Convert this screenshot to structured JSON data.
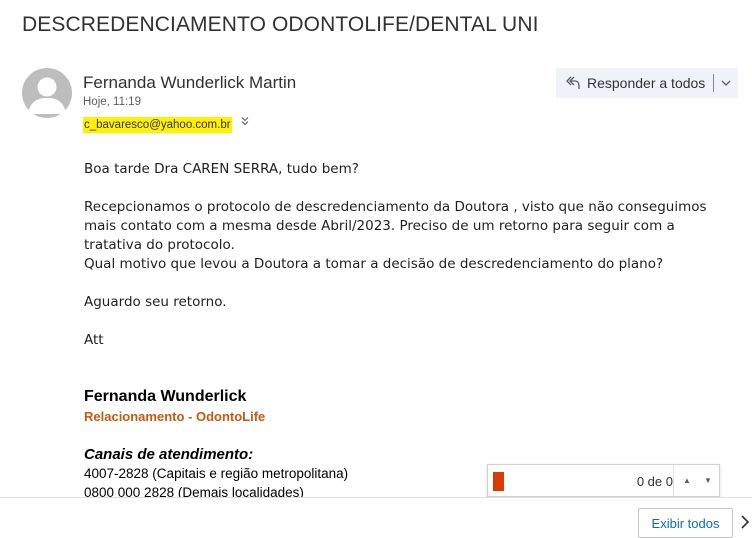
{
  "email": {
    "subject": "DESCREDENCIAMENTO ODONTOLIFE/DENTAL UNI",
    "sender_name": "Fernanda Wunderlick Martin",
    "sent_time": "Hoje, 11:19",
    "to_address": "c_bavaresco@yahoo.com.br",
    "reply_all_label": "Responder a todos"
  },
  "body": {
    "greeting": "Boa tarde Dra CAREN SERRA, tudo bem?",
    "paragraph1": "Recepcionamos o protocolo de descredenciamento da Doutora , visto que não conseguimos mais contato com a mesma desde Abril/2023. Preciso de um retorno para seguir com a tratativa do protocolo.",
    "paragraph2": "Qual motivo que levou a Doutora a tomar a decisão de descredenciamento do plano?",
    "closing": "Aguardo seu retorno.",
    "sign_off": "Att"
  },
  "signature": {
    "name": "Fernanda Wunderlick",
    "role": "Relacionamento - OdontoLife",
    "channels_heading": "Canais de atendimento:",
    "phone1": "4007-2828 (Capitais e região metropolitana)",
    "phone2": "0800 000 2828 (Demais localidades)"
  },
  "find_bar": {
    "count": "0 de 0",
    "highlight_color": "#d83b01"
  },
  "footer": {
    "show_all_label": "Exibir todos"
  },
  "icons": [
    "avatar",
    "reply-all-icon",
    "chevron-down-icon",
    "expand-recipients-icon",
    "find-previous-icon",
    "find-next-icon",
    "next-chevron-icon"
  ]
}
